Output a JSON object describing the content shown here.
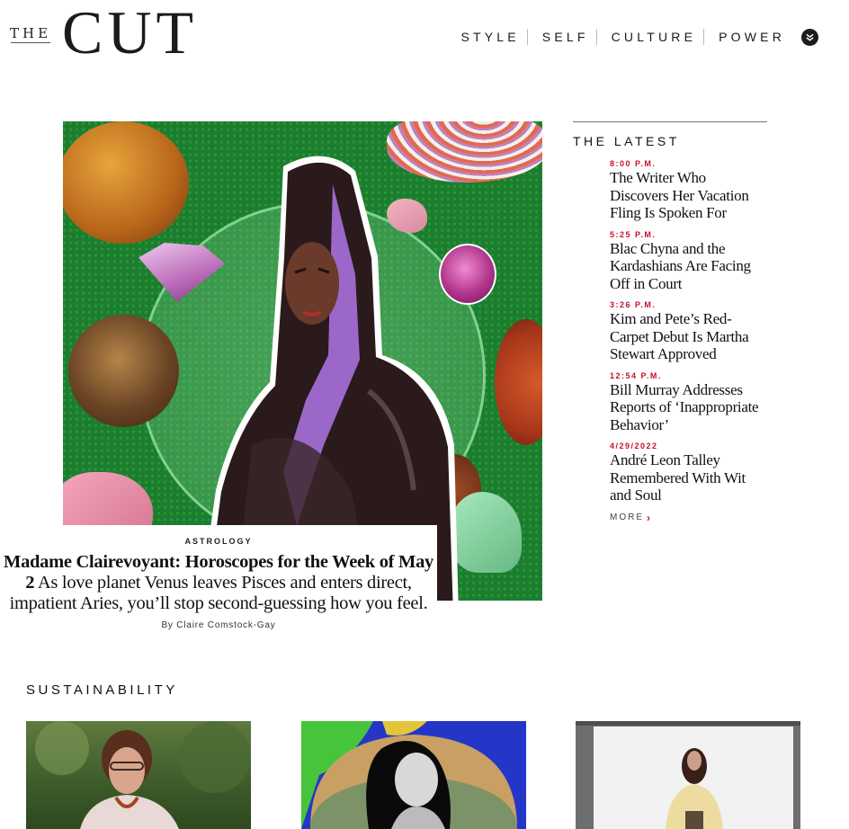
{
  "header": {
    "logo_the": "THE",
    "logo_cut": "CUT",
    "nav": [
      {
        "label": "STYLE"
      },
      {
        "label": "SELF"
      },
      {
        "label": "CULTURE"
      },
      {
        "label": "POWER"
      }
    ],
    "more_icon": "double-chevron-down-icon"
  },
  "hero": {
    "image_alt": "Collage of a woman in a purple hood and leather coat surrounded by planets and gemstones on green glitter",
    "rubric": "ASTROLOGY",
    "headline": "Madame Clairevoyant: Horoscopes for the Week of May 2",
    "dek": "As love planet Venus leaves Pisces and enters direct, impatient Aries, you’ll stop second-guessing how you feel.",
    "byline": "By Claire Comstock-Gay"
  },
  "latest": {
    "title": "THE LATEST",
    "items": [
      {
        "time": "8:00 P.M.",
        "headline": "The Writer Who Discovers Her Vacation Fling Is Spoken For"
      },
      {
        "time": "5:25 P.M.",
        "headline": "Blac Chyna and the Kardashians Are Facing Off in Court"
      },
      {
        "time": "3:26 P.M.",
        "headline": "Kim and Pete’s Red-Carpet Debut Is Martha Stewart Approved"
      },
      {
        "time": "12:54 P.M.",
        "headline": "Bill Murray Addresses Reports of ‘Inappropriate Behavior’"
      },
      {
        "time": "4/29/2022",
        "headline": "André Leon Talley Remembered With Wit and Soul"
      }
    ],
    "more_label": "MORE",
    "accent_color": "#c8102e"
  },
  "sustainability": {
    "title": "SUSTAINABILITY",
    "cards": [
      {
        "image_alt": "Older woman with curly hair and glasses in front of greenery"
      },
      {
        "image_alt": "Black and white portrait of woman with curly hair over a colorful heat map"
      },
      {
        "image_alt": "Woman in a patterned jacket standing in a white photo studio"
      }
    ]
  }
}
